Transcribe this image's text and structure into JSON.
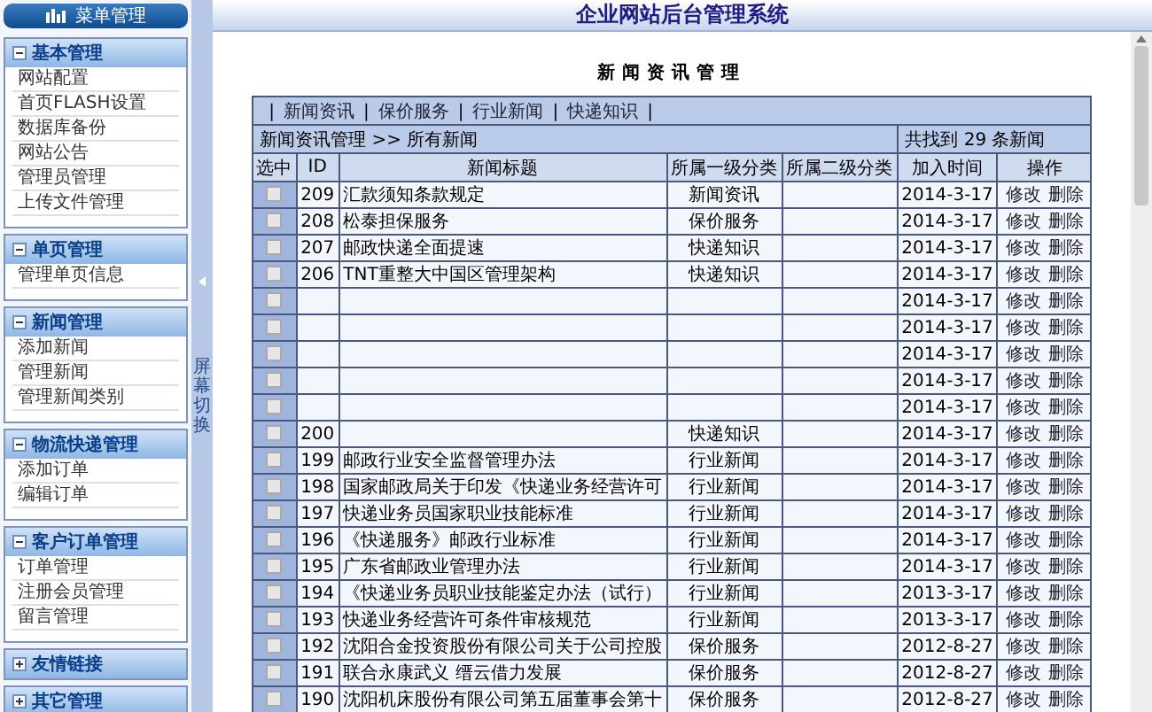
{
  "sidebar": {
    "title": "菜单管理",
    "groups": [
      {
        "title": "基本管理",
        "expanded": true,
        "items": [
          "网站配置",
          "首页FLASH设置",
          "数据库备份",
          "网站公告",
          "管理员管理",
          "上传文件管理"
        ]
      },
      {
        "title": "单页管理",
        "expanded": true,
        "items": [
          "管理单页信息"
        ]
      },
      {
        "title": "新闻管理",
        "expanded": true,
        "items": [
          "添加新闻",
          "管理新闻",
          "管理新闻类别"
        ]
      },
      {
        "title": "物流快递管理",
        "expanded": true,
        "items": [
          "添加订单",
          "编辑订单"
        ]
      },
      {
        "title": "客户订单管理",
        "expanded": true,
        "items": [
          "订单管理",
          "注册会员管理",
          "留言管理"
        ]
      },
      {
        "title": "友情链接",
        "expanded": false
      },
      {
        "title": "其它管理",
        "expanded": false
      }
    ]
  },
  "splitter": {
    "label": "屏幕切换"
  },
  "header": {
    "title": "企业网站后台管理系统"
  },
  "page_title": "新闻资讯管理",
  "category_links": [
    "新闻资讯",
    "保价服务",
    "行业新闻",
    "快递知识"
  ],
  "link_separator": "|",
  "breadcrumb": "新闻资讯管理 >> 所有新闻",
  "result_count": "共找到 29 条新闻",
  "table": {
    "columns": [
      "选中",
      "ID",
      "新闻标题",
      "所属一级分类",
      "所属二级分类",
      "加入时间",
      "操作"
    ],
    "rows": [
      {
        "checked": false,
        "id": "209",
        "title": "汇款须知条款规定",
        "category": "新闻资讯",
        "date": "2014-3-17",
        "actions": [
          "修改",
          "删除"
        ]
      },
      {
        "checked": false,
        "id": "208",
        "title": "松泰担保服务",
        "category": "保价服务",
        "date": "2014-3-17",
        "actions": [
          "修改",
          "删除"
        ]
      },
      {
        "checked": false,
        "id": "207",
        "title": "邮政快递全面提速",
        "category": "快递知识",
        "date": "2014-3-17",
        "actions": [
          "修改",
          "删除"
        ]
      },
      {
        "checked": false,
        "id": "206",
        "title": "TNT重整大中国区管理架构",
        "category": "快递知识",
        "date": "2014-3-17",
        "actions": [
          "修改",
          "删除"
        ]
      },
      {
        "checked": false,
        "date": "2014-3-17",
        "actions": [
          "修改",
          "删除"
        ]
      },
      {
        "checked": false,
        "date": "2014-3-17",
        "actions": [
          "修改",
          "删除"
        ]
      },
      {
        "checked": false,
        "date": "2014-3-17",
        "actions": [
          "修改",
          "删除"
        ]
      },
      {
        "checked": false,
        "date": "2014-3-17",
        "actions": [
          "修改",
          "删除"
        ]
      },
      {
        "checked": false,
        "date": "2014-3-17",
        "actions": [
          "修改",
          "删除"
        ]
      },
      {
        "checked": false,
        "id": "200",
        "category": "快递知识",
        "date": "2014-3-17",
        "actions": [
          "修改",
          "删除"
        ]
      },
      {
        "checked": false,
        "id": "199",
        "title": "邮政行业安全监督管理办法",
        "category": "行业新闻",
        "date": "2014-3-17",
        "actions": [
          "修改",
          "删除"
        ]
      },
      {
        "checked": false,
        "id": "198",
        "title": "国家邮政局关于印发《快递业务经营许可",
        "category": "行业新闻",
        "date": "2014-3-17",
        "actions": [
          "修改",
          "删除"
        ]
      },
      {
        "checked": false,
        "id": "197",
        "title": "快递业务员国家职业技能标准",
        "category": "行业新闻",
        "date": "2014-3-17",
        "actions": [
          "修改",
          "删除"
        ]
      },
      {
        "checked": false,
        "id": "196",
        "title": "《快递服务》邮政行业标准",
        "category": "行业新闻",
        "date": "2014-3-17",
        "actions": [
          "修改",
          "删除"
        ]
      },
      {
        "checked": false,
        "id": "195",
        "title": "广东省邮政业管理办法",
        "category": "行业新闻",
        "date": "2014-3-17",
        "actions": [
          "修改",
          "删除"
        ]
      },
      {
        "checked": false,
        "id": "194",
        "title": "《快递业务员职业技能鉴定办法（试行）",
        "category": "行业新闻",
        "date": "2013-3-17",
        "actions": [
          "修改",
          "删除"
        ]
      },
      {
        "checked": false,
        "id": "193",
        "title": "快递业务经营许可条件审核规范",
        "category": "行业新闻",
        "date": "2013-3-17",
        "actions": [
          "修改",
          "删除"
        ]
      },
      {
        "checked": false,
        "id": "192",
        "title": "沈阳合金投资股份有限公司关于公司控股",
        "category": "保价服务",
        "date": "2012-8-27",
        "actions": [
          "修改",
          "删除"
        ]
      },
      {
        "checked": false,
        "id": "191",
        "title": "联合永康武义 缙云借力发展",
        "category": "保价服务",
        "date": "2012-8-27",
        "actions": [
          "修改",
          "删除"
        ]
      },
      {
        "checked": false,
        "id": "190",
        "title": "沈阳机床股份有限公司第五届董事会第十",
        "category": "保价服务",
        "date": "2012-8-27",
        "actions": [
          "修改",
          "删除"
        ]
      }
    ]
  }
}
